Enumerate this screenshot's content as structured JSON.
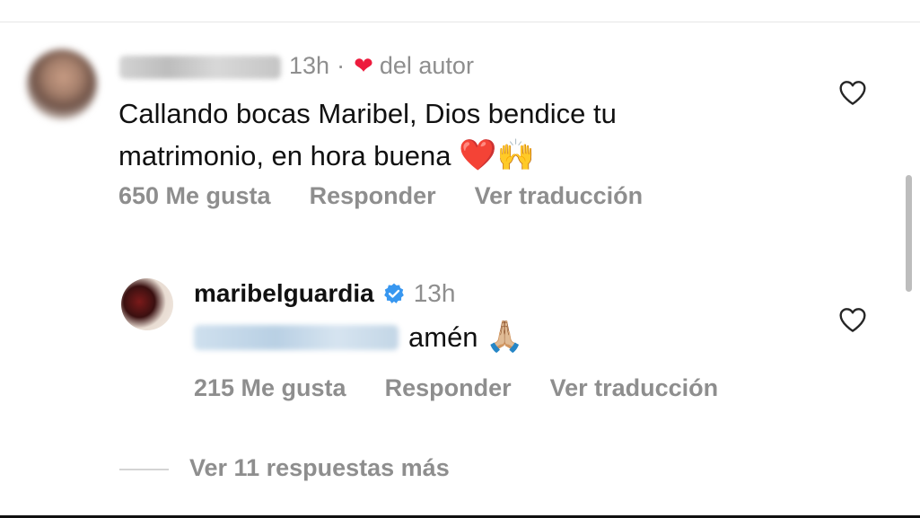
{
  "comment": {
    "time": "13h",
    "separator": "·",
    "author_like_label": "del autor",
    "text": "Callando bocas Maribel, Dios bendice tu matrimonio, en hora buena",
    "emojis": "❤️🙌",
    "likes": "650 Me gusta",
    "reply_label": "Responder",
    "translate_label": "Ver traducción"
  },
  "reply": {
    "username": "maribelguardia",
    "time": "13h",
    "text": "amén",
    "emoji": "🙏🏼",
    "likes": "215 Me gusta",
    "reply_label": "Responder",
    "translate_label": "Ver traducción"
  },
  "more_replies": "Ver 11 respuestas más",
  "colors": {
    "muted_text": "#8e8e8e",
    "heart_red": "#ed1b3d",
    "verified_blue": "#3897f0"
  },
  "icons": {
    "like": "heart-outline-icon",
    "verified": "verified-badge-icon",
    "author_like": "heart-filled-icon"
  }
}
